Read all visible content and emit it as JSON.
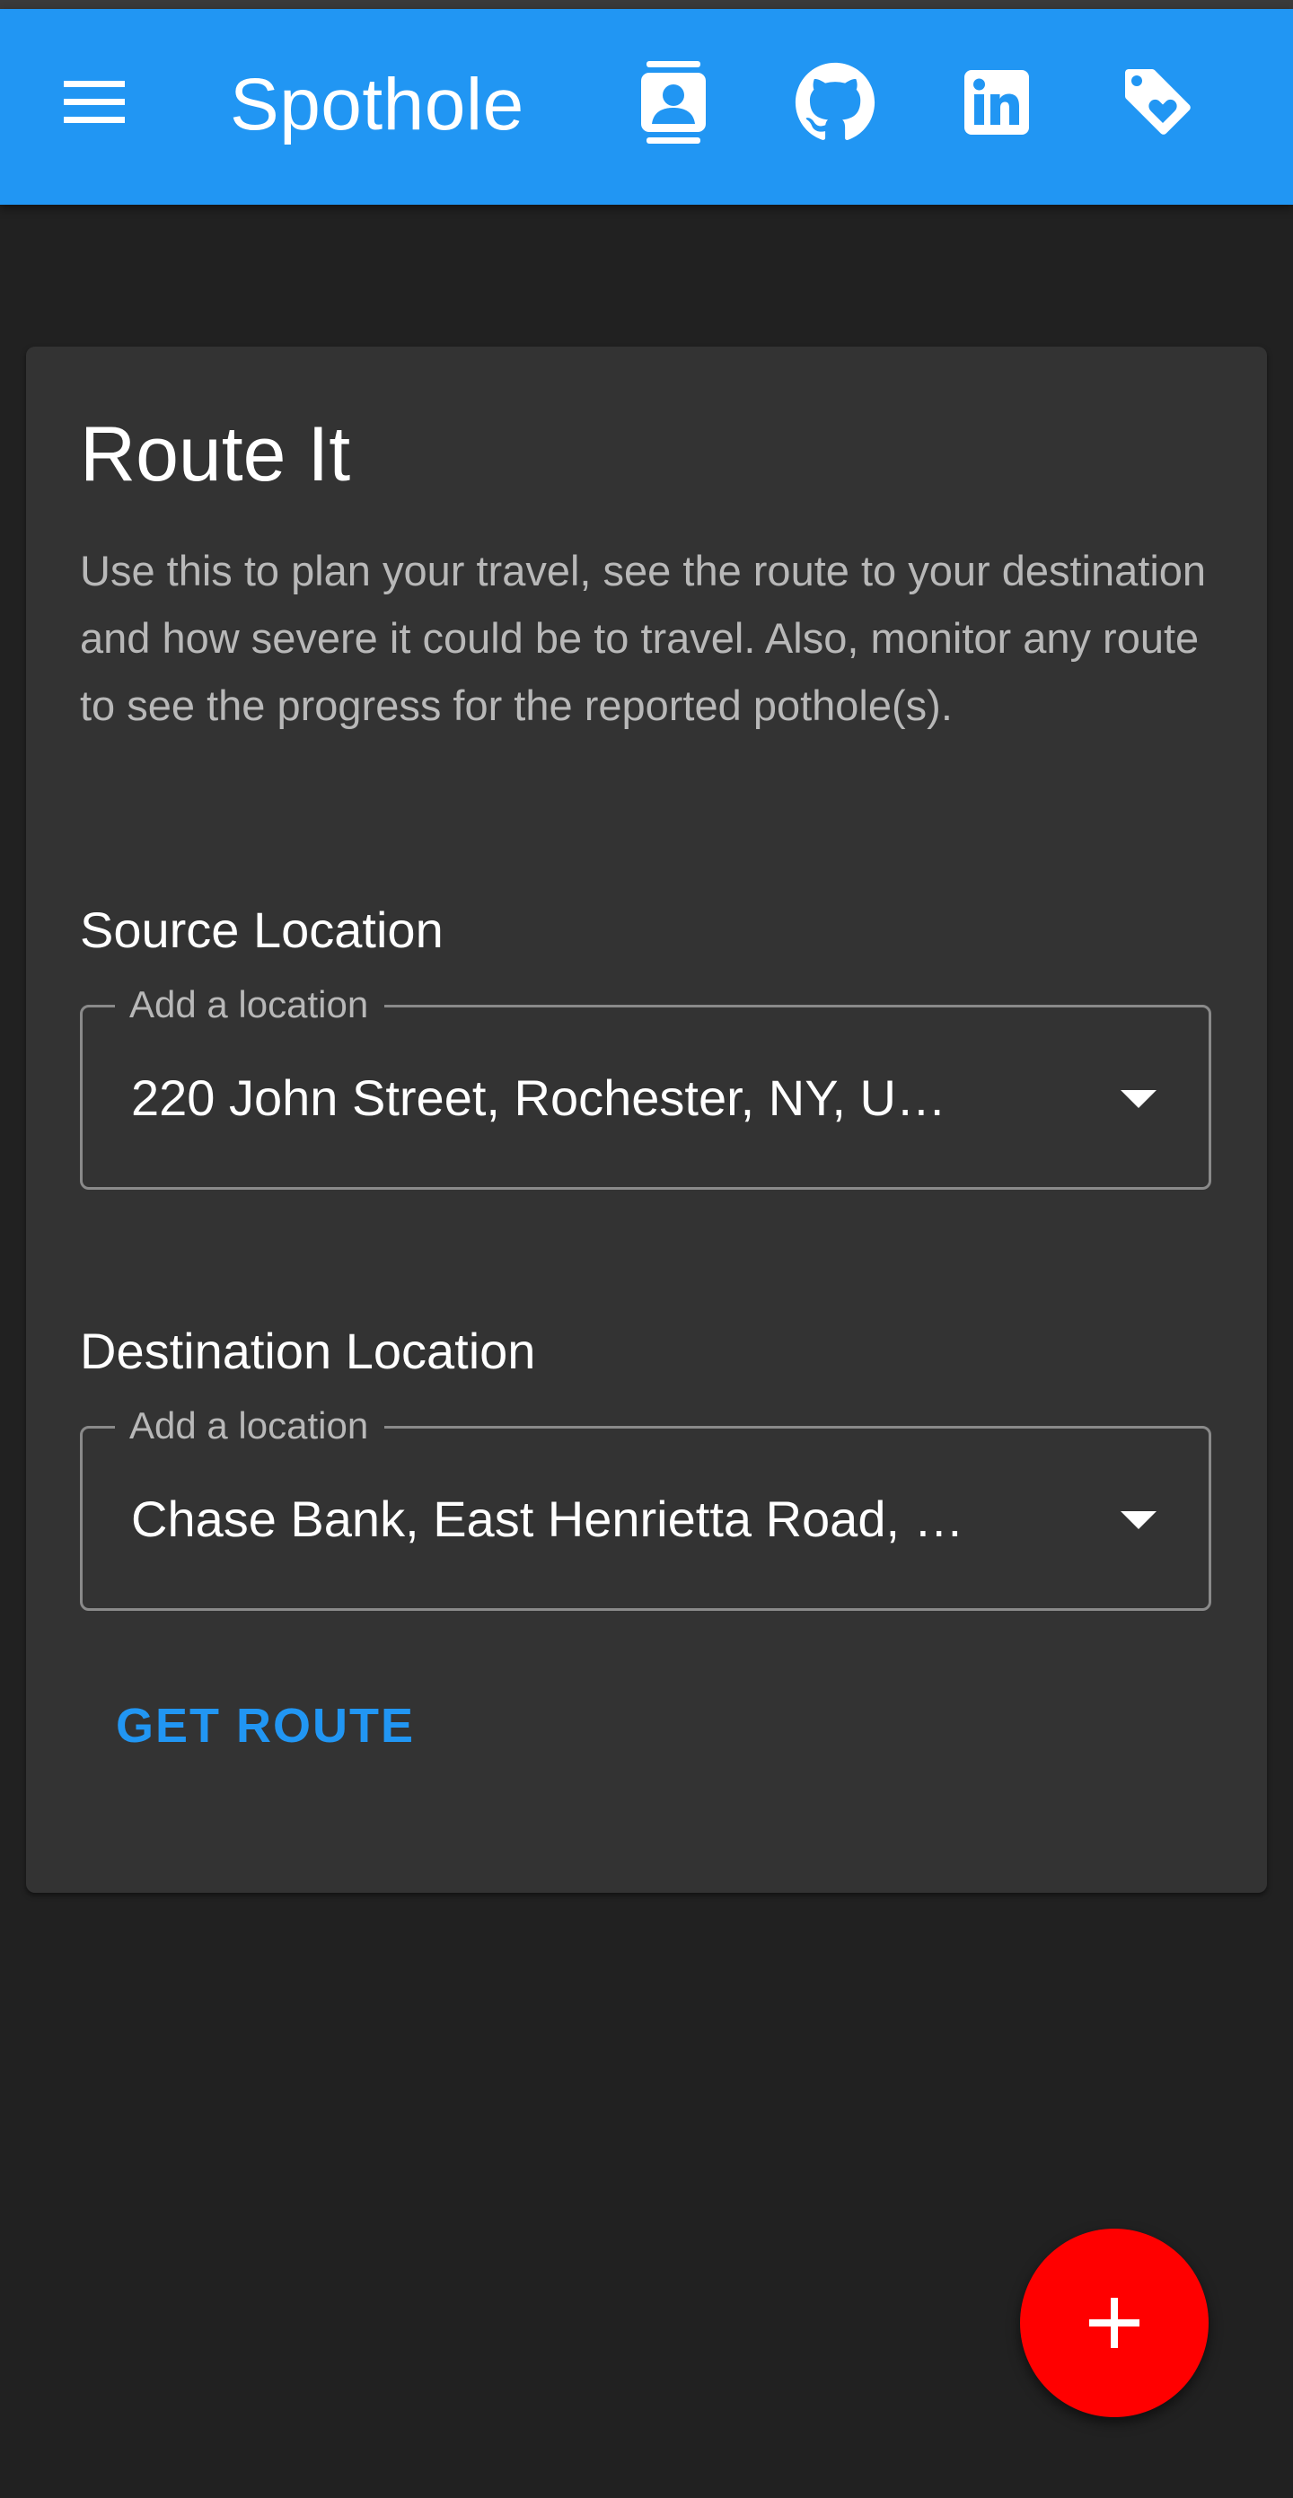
{
  "app_bar": {
    "title": "Spothole",
    "background_color": "#2196F3",
    "menu_icon": "menu-icon",
    "action_icons": [
      "contact-icon",
      "github-icon",
      "linkedin-icon",
      "tag-heart-icon"
    ]
  },
  "card": {
    "title": "Route It",
    "description": "Use this to plan your travel, see the route to your destination and how severe it could be to travel. Also, monitor any route to see the progress for the reported pothole(s).",
    "source": {
      "heading": "Source Location",
      "legend": "Add a location",
      "value": "220 John Street, Rochester, NY, U…"
    },
    "destination": {
      "heading": "Destination Location",
      "legend": "Add a location",
      "value": "Chase Bank, East Henrietta Road, …"
    },
    "action_label": "GET ROUTE"
  },
  "fab": {
    "icon": "plus-icon",
    "color": "#FF0000"
  }
}
